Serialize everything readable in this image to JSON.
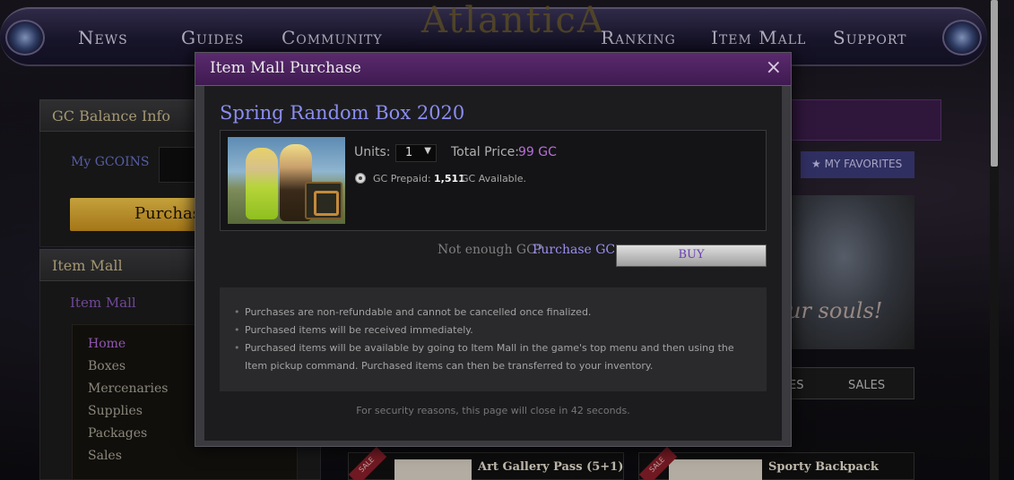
{
  "nav": {
    "items": [
      "News",
      "Guides",
      "Community",
      "Ranking",
      "Item Mall",
      "Support"
    ],
    "logo": "AtlanticA"
  },
  "sidebar": {
    "gc_header": "GC Balance Info",
    "my_gcoins_label": "My GCOINS",
    "purchase_button": "Purchas",
    "item_mall_header": "Item Mall",
    "item_mall_sub": "Item Mall",
    "categories": [
      "Home",
      "Boxes",
      "Mercenaries",
      "Supplies",
      "Packages",
      "Sales"
    ]
  },
  "right": {
    "favorites_label": "MY FAVORITES",
    "art_caption": "ur souls!",
    "tabs": [
      "ES",
      "SALES"
    ],
    "cards": [
      {
        "title": "Art Gallery Pass (5+1)",
        "ribbon": "SALE"
      },
      {
        "title": "Sporty Backpack",
        "ribbon": "SALE"
      }
    ]
  },
  "modal": {
    "title": "Item Mall Purchase",
    "close_glyph": "×",
    "product_name": "Spring Random Box 2020",
    "units_label": "Units:",
    "units_value": "1",
    "total_label": "Total Price:",
    "total_value": "99 GC",
    "prepaid_label": "GC Prepaid:",
    "prepaid_value": "1,511",
    "prepaid_suffix": "GC Available.",
    "not_enough": "Not enough GC?",
    "purchase_gc": "Purchase GC",
    "buy_label": "BUY",
    "notices": [
      "Purchases are non-refundable and cannot be cancelled once finalized.",
      "Purchased items will be received immediately.",
      "Purchased items will be available by going to Item Mall in the game's top menu and then using the Item pickup command. Purchased items can then be transferred to your inventory."
    ],
    "security_text": "For security reasons, this page will close in 42 seconds."
  },
  "colors": {
    "accent_purple": "#b76fd6",
    "link_blue": "#9a8ef0",
    "header_purple": "#5a2a6e"
  }
}
